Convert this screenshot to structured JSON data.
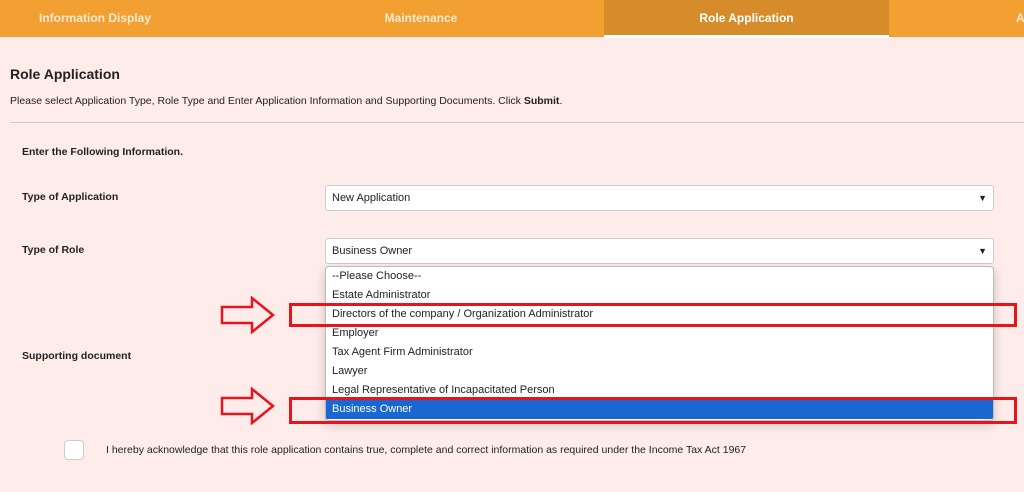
{
  "nav": {
    "tabs": [
      {
        "label": "Information Display"
      },
      {
        "label": "Maintenance"
      },
      {
        "label": "Role Application",
        "active": true
      },
      {
        "label": "A"
      }
    ]
  },
  "page": {
    "title": "Role Application",
    "description": "Please select Application Type, Role Type and Enter Application Information and Supporting Documents. Click ",
    "description_bold": "Submit",
    "description_end": "."
  },
  "form": {
    "section_label": "Enter the Following Information.",
    "application_type": {
      "label": "Type of Application",
      "value": "New Application"
    },
    "role_type": {
      "label": "Type of Role",
      "value": "Business Owner",
      "options": [
        "--Please Choose--",
        "Estate Administrator",
        "Directors of the company / Organization Administrator",
        "Employer",
        "Tax Agent Firm Administrator",
        "Lawyer",
        "Legal Representative of Incapacitated Person",
        "Business Owner"
      ],
      "selected": "Business Owner"
    },
    "supporting_document": {
      "label": "Supporting document"
    },
    "acknowledge": {
      "checked": false,
      "text": "I hereby acknowledge that this role application contains true, complete and correct information as required under the Income Tax Act 1967"
    }
  },
  "annotations": {
    "highlight_color": "#e8141c",
    "highlighted_options": [
      "Directors of the company / Organization Administrator",
      "Business Owner"
    ]
  },
  "colors": {
    "nav": "#f1a031",
    "nav_active": "#d68c2b",
    "selected_option": "#1a67d2",
    "background": "#fdecea"
  }
}
